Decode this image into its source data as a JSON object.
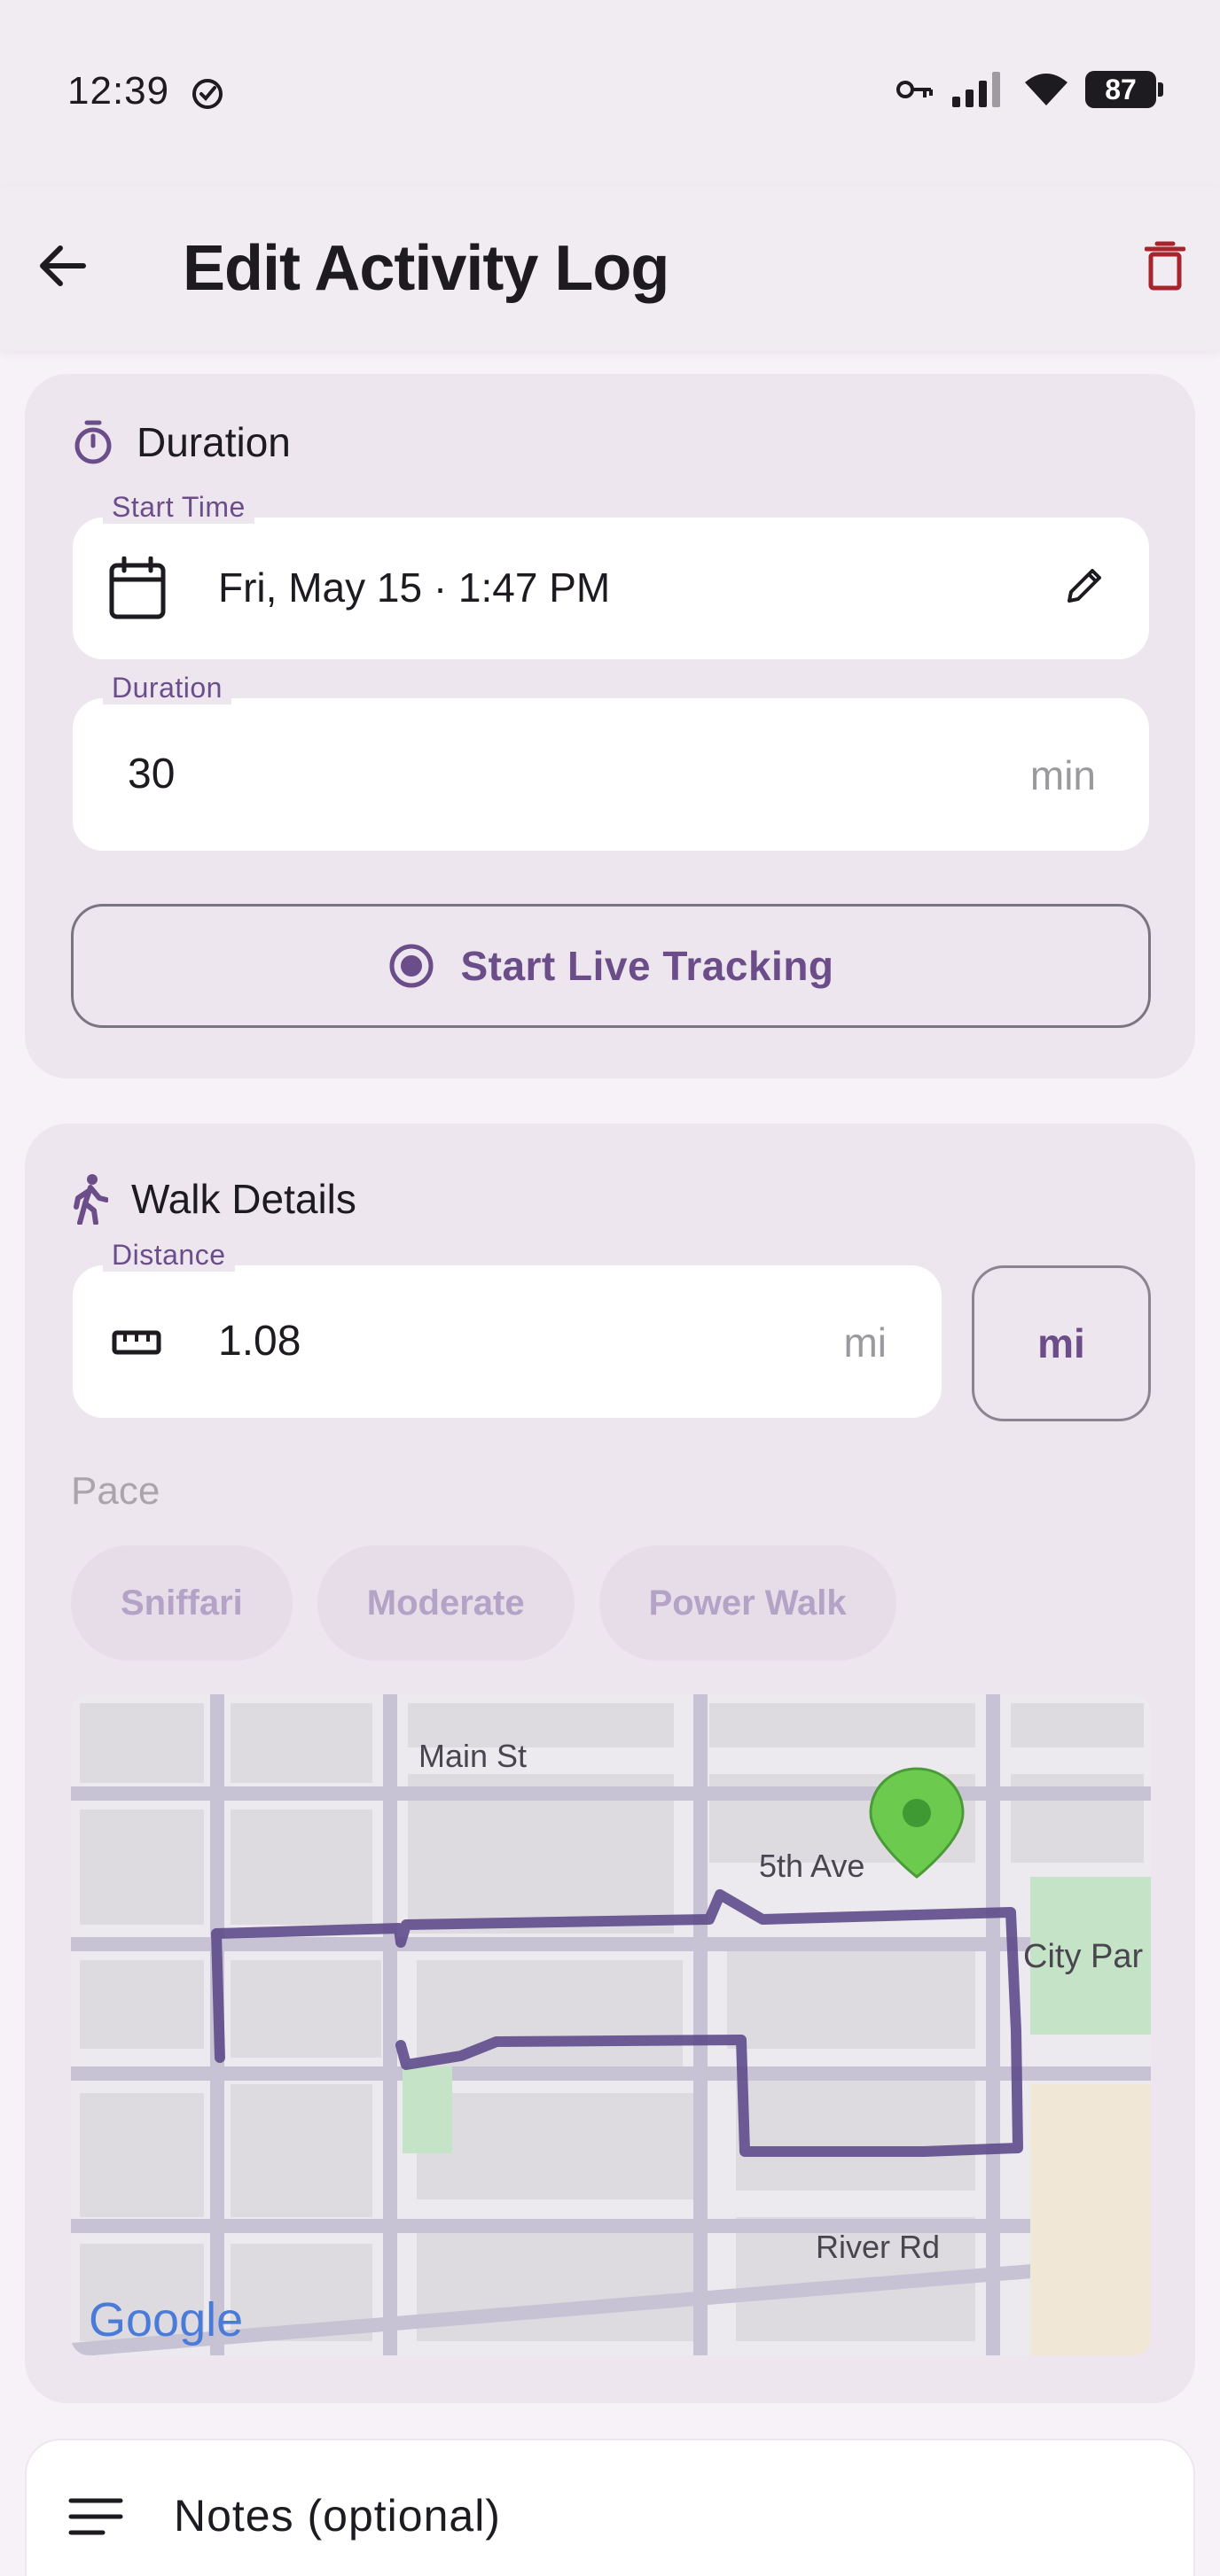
{
  "status_bar": {
    "time": "12:39",
    "battery": "87",
    "icons": [
      "check-circle-icon",
      "vpn-key-icon",
      "signal-icon",
      "wifi-icon",
      "battery-icon"
    ]
  },
  "app_bar": {
    "title": "Edit Activity Log",
    "back_icon": "arrow-back-icon",
    "delete_icon": "trash-icon",
    "delete_color": "#a8242c"
  },
  "duration_card": {
    "title": "Duration",
    "icon": "timer-icon",
    "start_time": {
      "label": "Start Time",
      "value": "Fri, May 15 · 1:47 PM",
      "icon": "calendar-icon",
      "edit_icon": "pencil-icon"
    },
    "duration": {
      "label": "Duration",
      "value": "30",
      "suffix": "min"
    },
    "live_tracking_label": "Start Live Tracking",
    "live_tracking_icon": "radio-record-icon"
  },
  "walk_card": {
    "title": "Walk Details",
    "icon": "walking-person-icon",
    "distance": {
      "label": "Distance",
      "value": "1.08",
      "suffix": "mi",
      "icon": "ruler-icon"
    },
    "unit_button": "mi",
    "pace_label": "Pace",
    "pace_options": [
      "Sniffari",
      "Moderate",
      "Power Walk"
    ],
    "map": {
      "streets": [
        "Main St",
        "5th Ave",
        "River Rd"
      ],
      "park": "City Par",
      "brand": "Google",
      "pin_icon": "map-pin-icon",
      "route_color": "#5e4b8b"
    }
  },
  "notes": {
    "label": "Notes (optional)",
    "icon": "notes-lines-icon"
  },
  "colors": {
    "accent": "#6b4d8a",
    "card": "#ede6ee",
    "background": "#f7f1f8"
  }
}
